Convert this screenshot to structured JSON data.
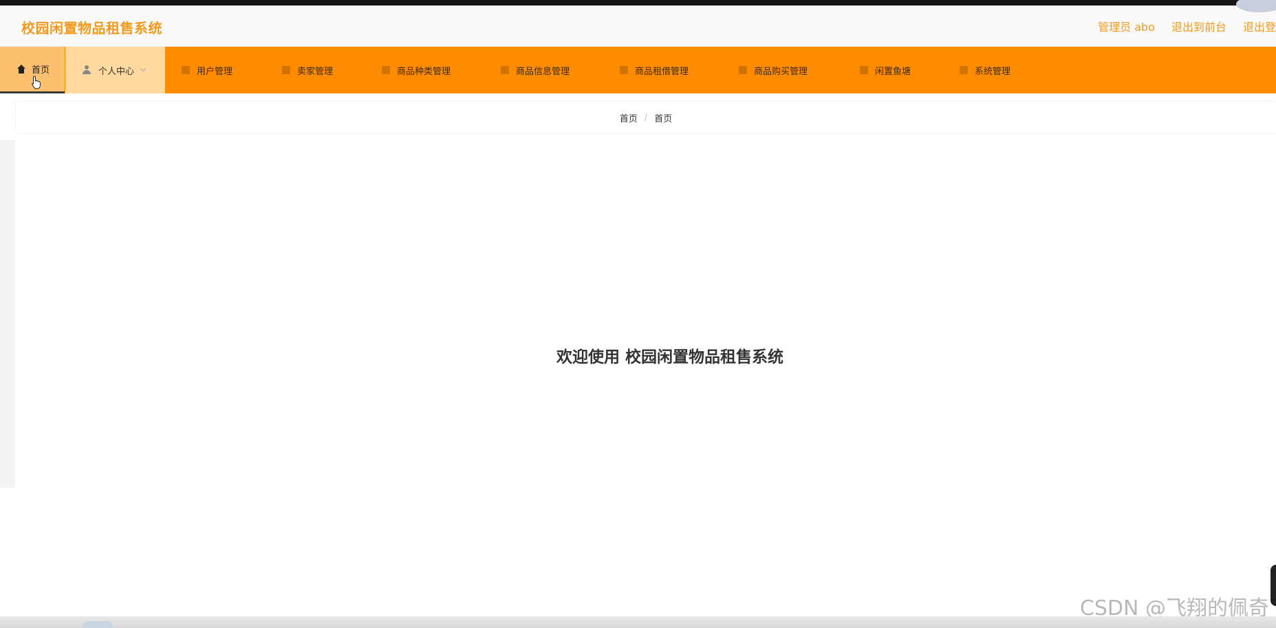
{
  "header": {
    "title": "校园闲置物品租售系统",
    "user_label": "管理员 abo",
    "to_front_label": "退出到前台",
    "logout_label": "退出登"
  },
  "nav": {
    "items": [
      {
        "label": "首页",
        "icon": "home-icon"
      },
      {
        "label": "个人中心",
        "icon": "user-icon"
      },
      {
        "label": "用户管理",
        "icon": "menu-icon"
      },
      {
        "label": "卖家管理",
        "icon": "menu-icon"
      },
      {
        "label": "商品种类管理",
        "icon": "menu-icon"
      },
      {
        "label": "商品信息管理",
        "icon": "menu-icon"
      },
      {
        "label": "商品租借管理",
        "icon": "menu-icon"
      },
      {
        "label": "商品购买管理",
        "icon": "menu-icon"
      },
      {
        "label": "闲置鱼塘",
        "icon": "menu-icon"
      },
      {
        "label": "系统管理",
        "icon": "menu-icon"
      }
    ]
  },
  "breadcrumb": {
    "items": [
      "首页",
      "首页"
    ],
    "separator": "/"
  },
  "main": {
    "welcome": "欢迎使用 校园闲置物品租售系统"
  },
  "watermark": "CSDN @飞翔的佩奇",
  "colors": {
    "accent": "#ff8c00",
    "title": "#f39a1c",
    "active_nav": "#fdc06f",
    "hover_nav": "#ffd9a0"
  }
}
